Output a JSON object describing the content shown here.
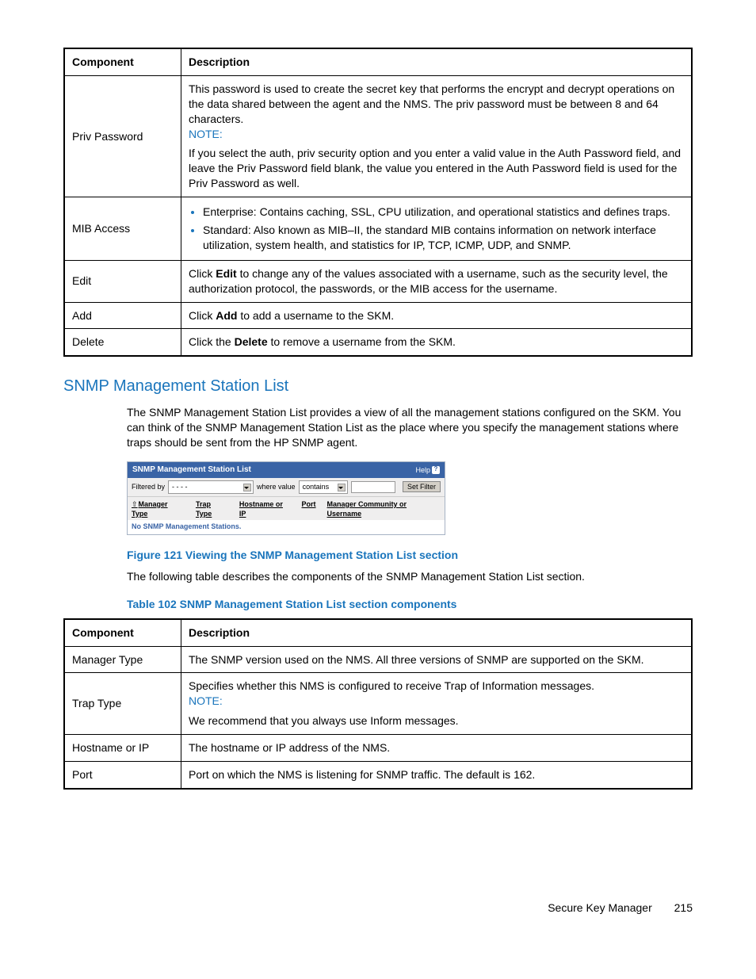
{
  "table1": {
    "headers": [
      "Component",
      "Description"
    ],
    "rows": [
      {
        "component": "Priv Password",
        "desc_intro": "This password is used to create the secret key that performs the encrypt and decrypt operations on the data shared between the agent and the NMS. The priv password must be between 8 and 64 characters.",
        "note_label": "NOTE:",
        "desc_note": "If you select the auth, priv security option and you enter a valid value in the Auth Password field, and leave the Priv Password field blank, the value you entered in the Auth Password field is used for the Priv Password as well."
      },
      {
        "component": "MIB Access",
        "bullets": [
          "Enterprise: Contains caching, SSL, CPU utilization, and operational statistics and defines traps.",
          "Standard: Also known as MIB–II, the standard MIB contains information on network interface utilization, system health, and statistics for IP, TCP, ICMP, UDP, and SNMP."
        ]
      },
      {
        "component": "Edit",
        "desc_pre": "Click ",
        "desc_bold": "Edit",
        "desc_post": " to change any of the values associated with a username, such as the security level, the authorization protocol, the passwords, or the MIB access for the username."
      },
      {
        "component": "Add",
        "desc_pre": "Click ",
        "desc_bold": "Add",
        "desc_post": " to add a username to the SKM."
      },
      {
        "component": "Delete",
        "desc_pre": "Click the ",
        "desc_bold": "Delete",
        "desc_post": " to remove a username from the SKM."
      }
    ]
  },
  "section": {
    "heading": "SNMP Management Station List",
    "intro": "The SNMP Management Station List provides a view of all the management stations configured on the SKM. You can think of the SNMP Management Station List as the place where you specify the management stations where traps should be sent from the HP SNMP agent."
  },
  "screenshot": {
    "title": "SNMP Management Station List",
    "help": "Help",
    "filter_label": "Filtered by",
    "sel1": "- - - -",
    "where_label": "where value",
    "sel2": "contains",
    "btn": "Set Filter",
    "cols": [
      "Manager Type",
      "Trap Type",
      "Hostname or IP",
      "Port",
      "Manager Community or Username"
    ],
    "msg": "No SNMP Management Stations."
  },
  "figcap1": "Figure 121 Viewing the SNMP Management Station List section",
  "para2": "The following table describes the components of the SNMP Management Station List section.",
  "tabcap2": "Table 102 SNMP Management Station List section components",
  "table2": {
    "headers": [
      "Component",
      "Description"
    ],
    "rows": [
      {
        "component": "Manager Type",
        "desc": "The SNMP version used on the NMS. All three versions of SNMP are supported on the SKM."
      },
      {
        "component": "Trap Type",
        "desc_pre": "Specifies whether this NMS is configured to receive Trap of Information messages.",
        "note_label": "NOTE:",
        "desc_note": "We recommend that you always use Inform messages."
      },
      {
        "component": "Hostname or IP",
        "desc": "The hostname or IP address of the NMS."
      },
      {
        "component": "Port",
        "desc": "Port on which the NMS is listening for SNMP traffic. The default is 162."
      }
    ]
  },
  "footer": {
    "title": "Secure Key Manager",
    "page": "215"
  }
}
